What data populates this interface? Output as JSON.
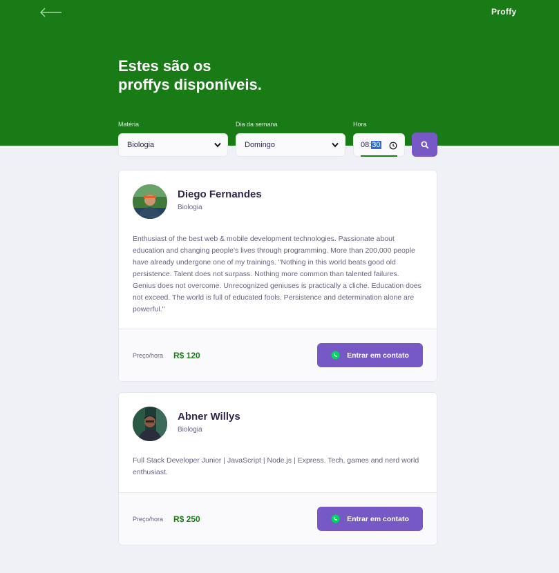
{
  "header": {
    "logo": "Proffy",
    "title_line1": "Estes são os",
    "title_line2": "proffys disponíveis."
  },
  "filters": {
    "subject_label": "Matéria",
    "subject_value": "Biologia",
    "weekday_label": "Dia da semana",
    "weekday_value": "Domingo",
    "time_label": "Hora",
    "time_hours": "08:",
    "time_minutes": "30"
  },
  "colors": {
    "primary_green": "#187b16",
    "button_purple": "#7659c4",
    "whatsapp_green": "#04d361",
    "background": "#f0f0f7"
  },
  "teachers": [
    {
      "name": "Diego Fernandes",
      "subject": "Biologia",
      "bio": "Enthusiast of the best web & mobile development technologies. Passionate about education and changing people's lives through programming. More than 200,000 people have already undergone one of my trainings. \"Nothing in this world beats good old persistence. Talent does not surpass. Nothing more common than talented failures. Genius does not overcome. Unrecognized geniuses is practically a cliche. Education does not exceed. The world is full of educated fools. Persistence and determination alone are powerful.\"",
      "price_label": "Preço/hora",
      "price": "R$ 120",
      "contact_label": "Entrar em contato"
    },
    {
      "name": "Abner Willys",
      "subject": "Biologia",
      "bio": "Full Stack Developer Junior | JavaScript | Node.js | Express. Tech, games and nerd world enthusiast.",
      "price_label": "Preço/hora",
      "price": "R$ 250",
      "contact_label": "Entrar em contato"
    }
  ]
}
